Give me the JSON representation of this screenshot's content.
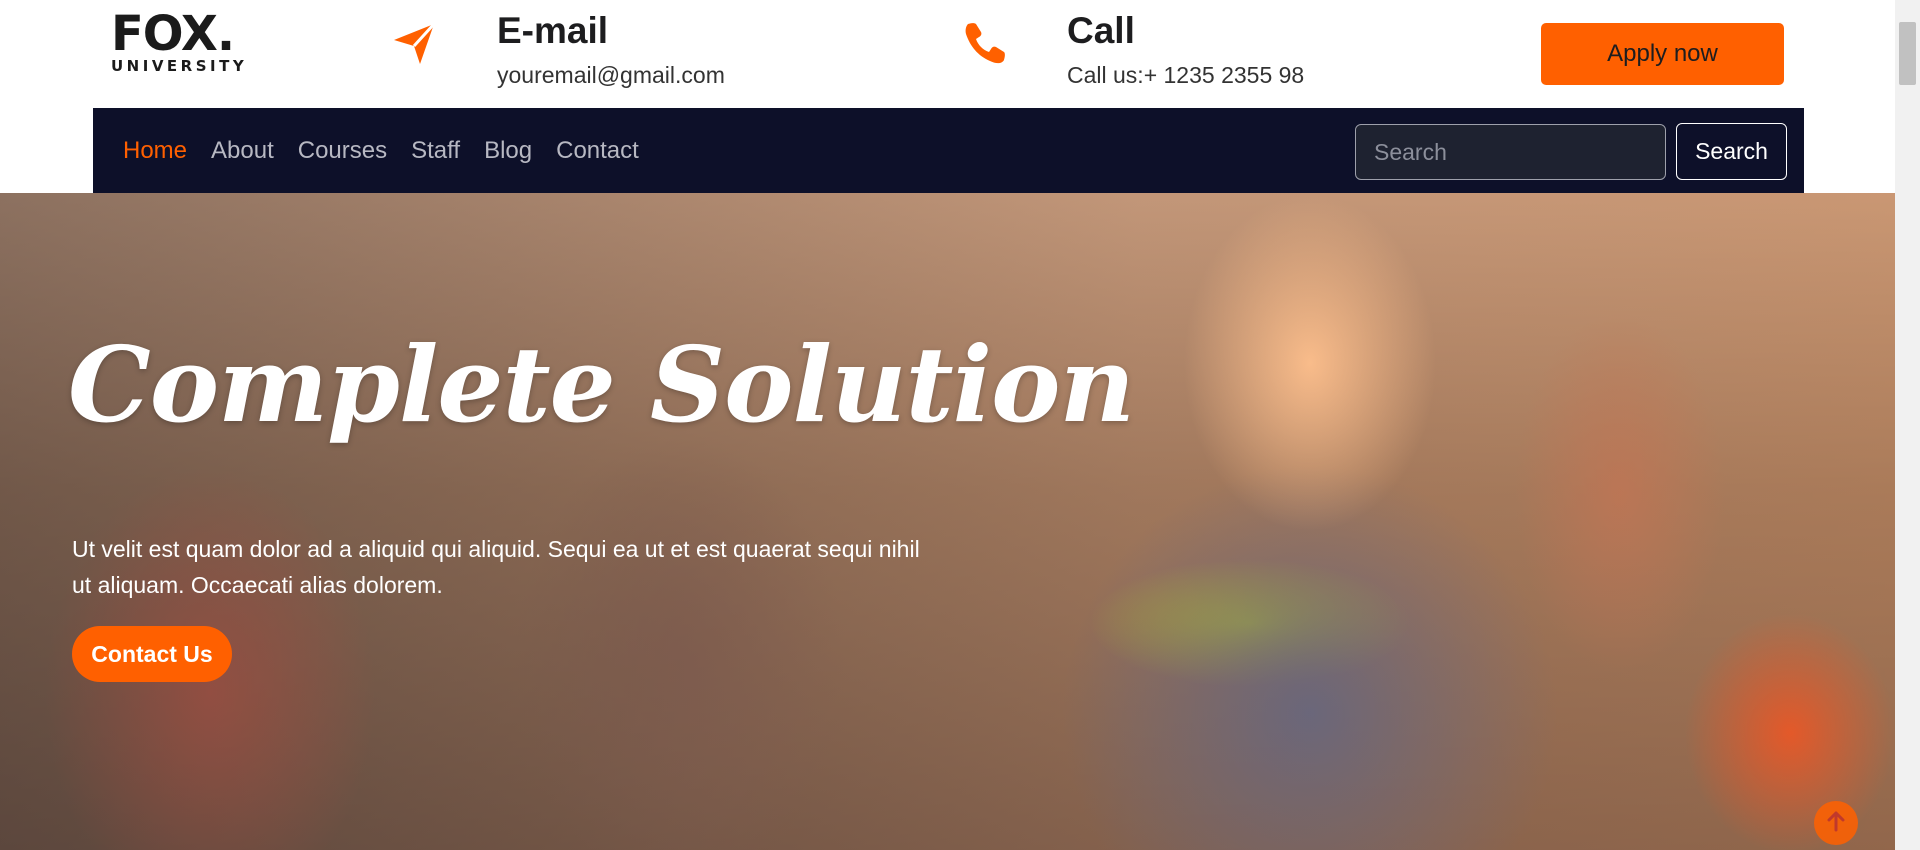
{
  "logo": {
    "main": "FOX.",
    "sub": "UNIVERSITY"
  },
  "email": {
    "icon": "paper-plane-icon",
    "title": "E-mail",
    "value": "youremail@gmail.com"
  },
  "call": {
    "icon": "phone-icon",
    "title": "Call",
    "value": "Call us:+ 1235 2355 98"
  },
  "apply_button": "Apply now",
  "nav": {
    "items": [
      {
        "label": "Home",
        "active": true
      },
      {
        "label": "About"
      },
      {
        "label": "Courses"
      },
      {
        "label": "Staff"
      },
      {
        "label": "Blog"
      },
      {
        "label": "Contact"
      }
    ],
    "search_placeholder": "Search",
    "search_button": "Search"
  },
  "hero": {
    "title": "Complete Solution",
    "text": "Ut velit est quam dolor ad a aliquid qui aliquid. Sequi ea ut et est quaerat sequi nihil ut aliquam. Occaecati alias dolorem.",
    "button": "Contact Us"
  },
  "colors": {
    "accent": "#ff6000",
    "navbar": "#0d1029",
    "heading": "#1d1d1f"
  },
  "icons": {
    "scroll_top": "arrow-up-icon"
  }
}
